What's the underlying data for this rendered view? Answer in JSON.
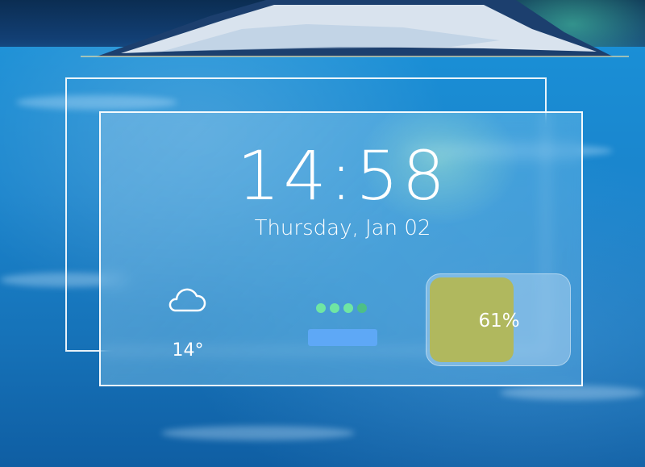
{
  "clock": {
    "time": "14:58",
    "date": "Thursday, Jan 02"
  },
  "weather": {
    "icon": "cloud-icon",
    "temperature": "14°"
  },
  "connectivity": {
    "indicator_dots": 4
  },
  "battery": {
    "level_label": "61%",
    "level_fraction": 0.61,
    "fill_color": "#b0b85e"
  },
  "colors": {
    "accent_green": "#6fe6a3",
    "accent_blue": "#5ea8f6"
  }
}
